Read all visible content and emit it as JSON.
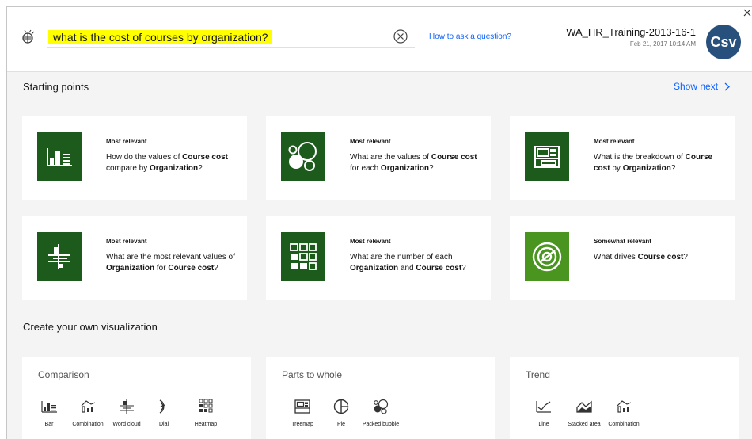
{
  "header": {
    "query": "what is the cost of courses by organization?",
    "howto_link": "How to ask a question?",
    "dataset_name": "WA_HR_Training-2013-16-1",
    "dataset_date": "Feb 21, 2017 10:14 AM",
    "avatar_text": "Csv"
  },
  "starting_points": {
    "title": "Starting points",
    "show_next": "Show next",
    "cards": [
      {
        "tag": "Most relevant",
        "pre1": "How do the values of ",
        "b1": "Course cost",
        "pre2": " compare by ",
        "b2": "Organization",
        "post": "?",
        "icon": "bar-chart-icon"
      },
      {
        "tag": "Most relevant",
        "pre1": "What are the values of ",
        "b1": "Course cost",
        "pre2": " for each ",
        "b2": "Organization",
        "post": "?",
        "icon": "packed-bubble-icon"
      },
      {
        "tag": "Most relevant",
        "pre1": "What is the breakdown of ",
        "b1": "Course cost",
        "pre2": " by ",
        "b2": "Organization",
        "post": "?",
        "icon": "treemap-icon"
      },
      {
        "tag": "Most relevant",
        "pre1": "What are the most relevant values of ",
        "b1": "Organization",
        "pre2": " for ",
        "b2": "Course cost",
        "post": "?",
        "icon": "word-cloud-icon"
      },
      {
        "tag": "Most relevant",
        "pre1": "What are the number of each ",
        "b1": "Organization",
        "pre2": " and ",
        "b2": "Course cost",
        "post": "?",
        "icon": "heatmap-icon"
      },
      {
        "tag": "Somewhat relevant",
        "pre1": "What drives ",
        "b1": "Course cost",
        "pre2": "",
        "b2": "",
        "post": "?",
        "icon": "driver-analysis-icon"
      }
    ]
  },
  "create_own": {
    "title": "Create your own visualization",
    "groups": [
      {
        "title": "Comparison",
        "items": [
          "Bar",
          "Combination",
          "Word cloud",
          "Dial",
          "Heatmap"
        ]
      },
      {
        "title": "Parts to whole",
        "items": [
          "Treemap",
          "Pie",
          "Packed bubble"
        ]
      },
      {
        "title": "Trend",
        "items": [
          "Line",
          "Stacked area",
          "Combination"
        ]
      }
    ]
  }
}
